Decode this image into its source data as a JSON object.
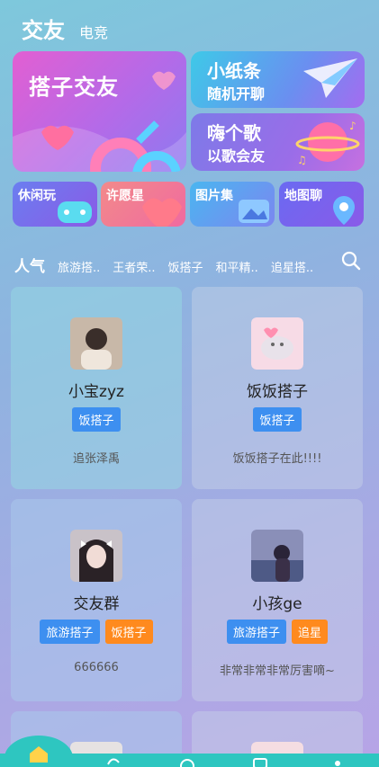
{
  "header": {
    "title": "交友",
    "subtitle": "电竞"
  },
  "banners": {
    "main": {
      "label": "搭子交友"
    },
    "paper": {
      "line1": "小纸条",
      "line2": "随机开聊"
    },
    "song": {
      "line1": "嗨个歌",
      "line2": "以歌会友"
    }
  },
  "mini_cards": [
    "休闲玩",
    "许愿星",
    "图片集",
    "地图聊"
  ],
  "tabs": {
    "active": "人气",
    "items": [
      "旅游搭..",
      "王者荣..",
      "饭搭子",
      "和平精..",
      "追星搭.."
    ]
  },
  "cards": [
    {
      "name": "小宝zyz",
      "tags": [
        "饭搭子"
      ],
      "desc": "追张泽禹"
    },
    {
      "name": "饭饭搭子",
      "tags": [
        "饭搭子"
      ],
      "desc": "饭饭搭子在此!!!!"
    },
    {
      "name": "交友群",
      "tags": [
        "旅游搭子",
        "饭搭子"
      ],
      "desc": "666666"
    },
    {
      "name": "小孩ge",
      "tags": [
        "旅游搭子",
        "追星"
      ],
      "desc": "非常非常非常厉害嘀~"
    }
  ],
  "colors": {
    "tag_blue": "#3d8ff0",
    "tag_orange": "#ff8a1e",
    "nav_teal": "#2ec6c0"
  },
  "icons": {
    "search": "search-icon",
    "home": "home-icon"
  }
}
